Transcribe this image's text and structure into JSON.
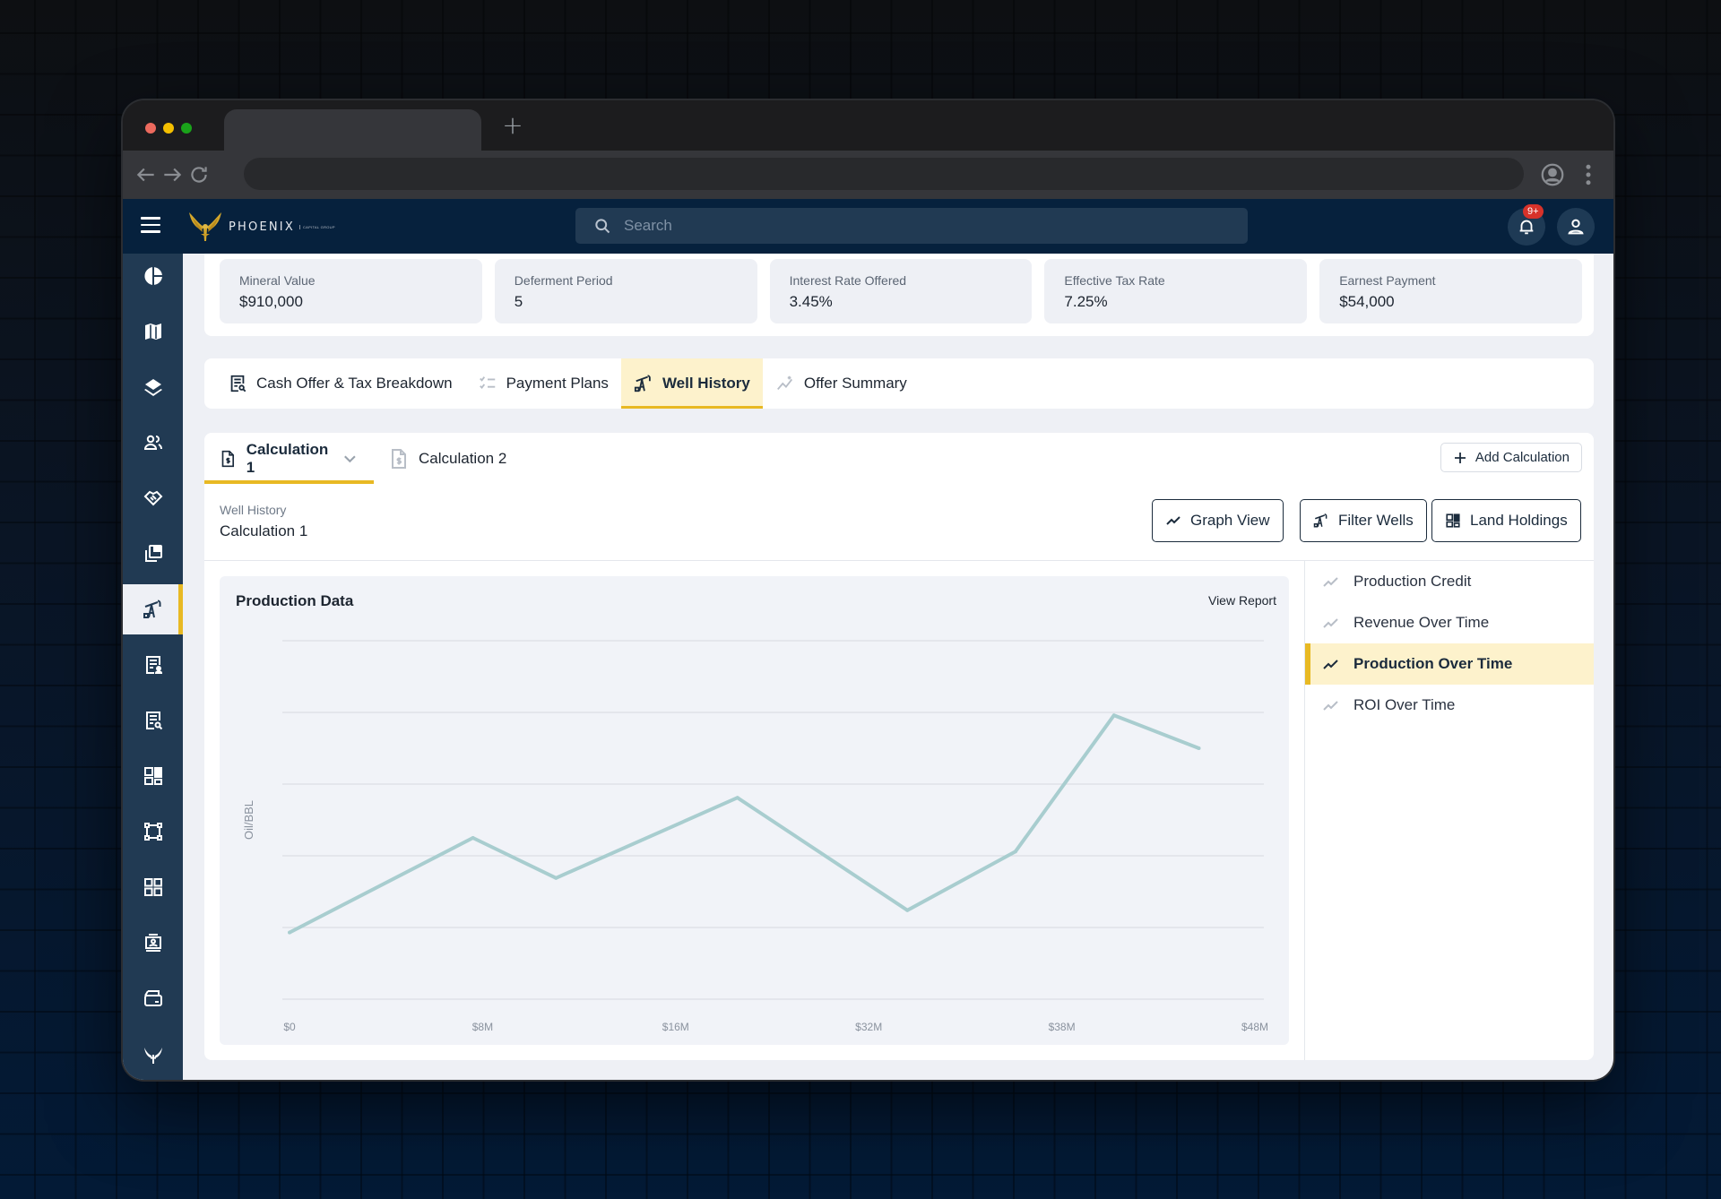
{
  "browser": {
    "new_tab_label": "+"
  },
  "header": {
    "brand": "PHOENIX",
    "brand_sub": "CAPITAL GROUP",
    "search_placeholder": "Search",
    "notification_count": "9+"
  },
  "sidebar": {
    "items": [
      {
        "icon": "pie-chart-icon",
        "label": "Dashboard"
      },
      {
        "icon": "map-icon",
        "label": "Map"
      },
      {
        "icon": "layers-icon",
        "label": "Layers"
      },
      {
        "icon": "users-icon",
        "label": "Users"
      },
      {
        "icon": "handshake-icon",
        "label": "Deals"
      },
      {
        "icon": "copy-icon",
        "label": "Documents"
      },
      {
        "icon": "oil-pump-icon",
        "label": "Wells",
        "active": true
      },
      {
        "icon": "report-user-icon",
        "label": "Reports"
      },
      {
        "icon": "report-search-icon",
        "label": "Search Reports"
      },
      {
        "icon": "dashboard-layout-icon",
        "label": "Layout"
      },
      {
        "icon": "bounding-box-icon",
        "label": "Boundaries"
      },
      {
        "icon": "grid-icon",
        "label": "Apps"
      },
      {
        "icon": "id-card-icon",
        "label": "Contacts"
      },
      {
        "icon": "folder-drawer-icon",
        "label": "Files"
      },
      {
        "icon": "phoenix-wings-icon",
        "label": "Phoenix"
      }
    ]
  },
  "stats": [
    {
      "label": "Mineral Value",
      "value": "$910,000"
    },
    {
      "label": "Deferment Period",
      "value": "5"
    },
    {
      "label": "Interest Rate Offered",
      "value": "3.45%"
    },
    {
      "label": "Effective Tax Rate",
      "value": "7.25%"
    },
    {
      "label": "Earnest Payment",
      "value": "$54,000"
    }
  ],
  "tabs": [
    {
      "label": "Cash Offer & Tax Breakdown",
      "icon": "receipt-search-icon"
    },
    {
      "label": "Payment Plans",
      "icon": "checklist-icon"
    },
    {
      "label": "Well History",
      "icon": "oil-pump-icon",
      "active": true
    },
    {
      "label": "Offer Summary",
      "icon": "sparkline-icon"
    }
  ],
  "calculations": {
    "tabs": [
      {
        "label": "Calculation 1",
        "active": true
      },
      {
        "label": "Calculation 2"
      }
    ],
    "add_label": "Add Calculation"
  },
  "section": {
    "label": "Well History",
    "title": "Calculation 1"
  },
  "view_buttons": {
    "graph_view": "Graph View",
    "filter_wells": "Filter Wells",
    "land_holdings": "Land Holdings"
  },
  "chart_panel": {
    "title": "Production Data",
    "view_report": "View Report"
  },
  "chart_list": [
    {
      "label": "Production Credit"
    },
    {
      "label": "Revenue Over Time"
    },
    {
      "label": "Production Over Time",
      "active": true
    },
    {
      "label": "ROI Over Time"
    }
  ],
  "colors": {
    "accent": "#e8b923",
    "header_bg": "#06213d",
    "sidebar_bg": "#213a53",
    "line": "#a8cdcf",
    "badge": "#d7322a"
  },
  "chart_data": {
    "type": "line",
    "title": "Production Data",
    "xlabel": "",
    "ylabel": "Oil/BBL",
    "x_tick_labels": [
      "$0",
      "$8M",
      "$16M",
      "$32M",
      "$38M",
      "$48M"
    ],
    "ylim": [
      0,
      5
    ],
    "y_gridlines": [
      0,
      1,
      2,
      3,
      4,
      5
    ],
    "y_tick_labels_shown": false,
    "grid": true,
    "legend": "none",
    "series": [
      {
        "name": "Production Over Time",
        "x": [
          0,
          0.95,
          1.38,
          2.32,
          3.2,
          3.76,
          4.27,
          4.71
        ],
        "values": [
          0.93,
          2.25,
          1.69,
          2.81,
          1.24,
          2.06,
          3.96,
          3.5
        ]
      }
    ]
  }
}
